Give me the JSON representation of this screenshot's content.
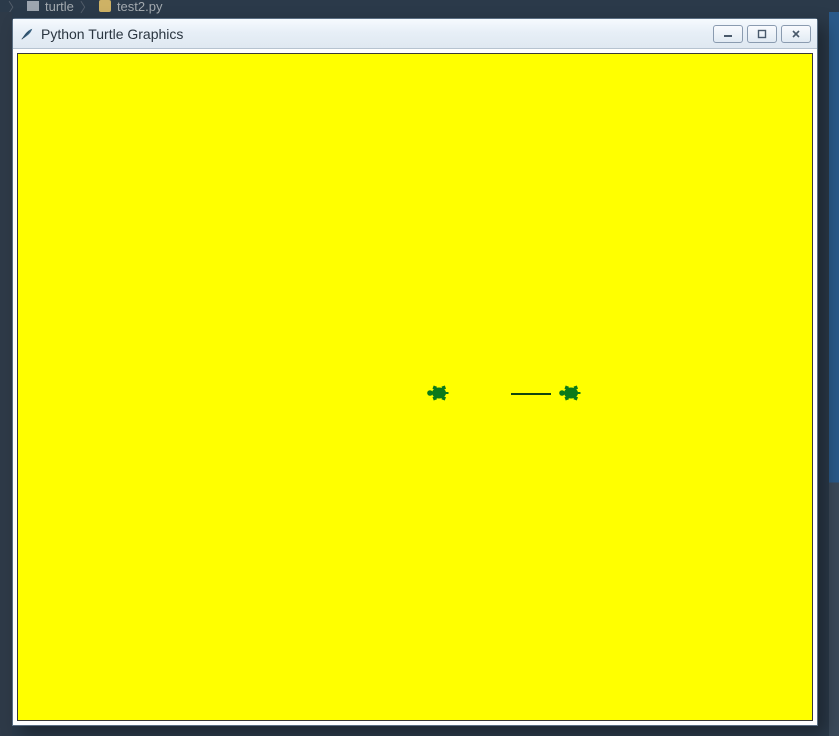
{
  "breadcrumb": {
    "folder": "turtle",
    "file": "test2.py"
  },
  "window": {
    "title": "Python Turtle Graphics"
  },
  "controls": {
    "minimize": "minimize",
    "maximize": "maximize",
    "close": "close"
  },
  "canvas": {
    "bg_color": "#ffff00",
    "turtle_color": "#0a7a1a",
    "turtle1": {
      "facing": "left"
    },
    "turtle2": {
      "facing": "left"
    },
    "line": {
      "from": "turtle2_start",
      "to": "turtle2_pos"
    }
  }
}
